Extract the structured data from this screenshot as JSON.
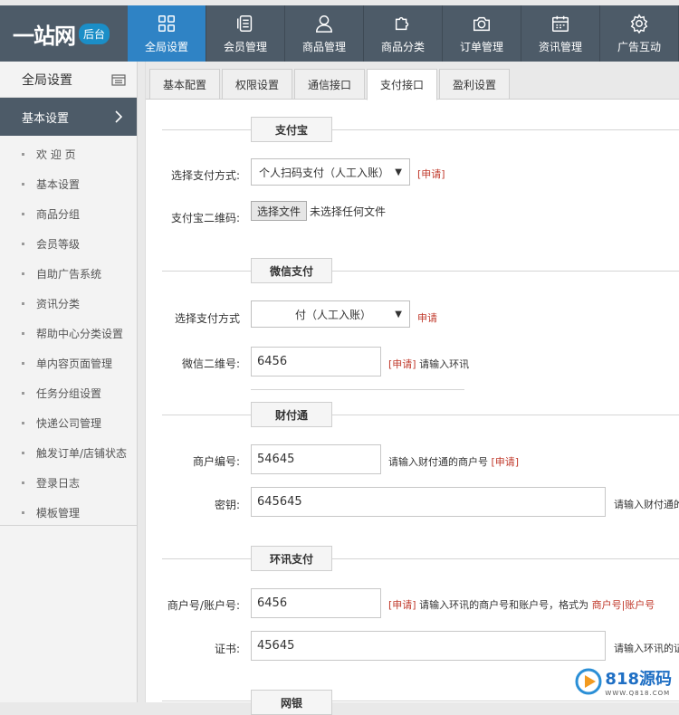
{
  "logo": {
    "text": "一站网",
    "badge": "后台"
  },
  "nav": [
    {
      "label": "全局设置",
      "icon": "grid-icon",
      "active": true
    },
    {
      "label": "会员管理",
      "icon": "id-card-icon"
    },
    {
      "label": "商品管理",
      "icon": "user-icon"
    },
    {
      "label": "商品分类",
      "icon": "puzzle-icon"
    },
    {
      "label": "订单管理",
      "icon": "camera-icon"
    },
    {
      "label": "资讯管理",
      "icon": "calendar-icon"
    },
    {
      "label": "广告互动",
      "icon": "gear-icon"
    }
  ],
  "sidebar": {
    "title": "全局设置",
    "active": "基本设置",
    "items": [
      "欢 迎 页",
      "基本设置",
      "商品分组",
      "会员等级",
      "自助广告系统",
      "资讯分类",
      "帮助中心分类设置",
      "单内容页面管理",
      "任务分组设置",
      "快递公司管理",
      "触发订单/店铺状态",
      "登录日志",
      "模板管理"
    ]
  },
  "tabs": [
    "基本配置",
    "权限设置",
    "通信接口",
    "支付接口",
    "盈利设置"
  ],
  "alipay": {
    "title": "支付宝",
    "method_label": "选择支付方式:",
    "method_value": "个人扫码支付（人工入账）",
    "apply": "[申请]",
    "qr_label": "支付宝二维码:",
    "file_button": "选择文件",
    "file_status": "未选择任何文件"
  },
  "wechat": {
    "title": "微信支付",
    "method_label": "选择支付方式",
    "method_value": "付（人工入账）",
    "apply": "申请",
    "qr_label": "微信二维",
    "qr_label_suffix": "号:",
    "qr_value": "6456",
    "qr_apply": "[申请]",
    "qr_hint": "请输入环讯"
  },
  "tenpay": {
    "title": "财付通",
    "merchant_label": "商户编号:",
    "merchant_value": "54645",
    "merchant_hint": "请输入财付通的商户号",
    "merchant_apply": "[申请]",
    "key_label": "密钥:",
    "key_value": "645645",
    "key_hint": "请输入财付通的"
  },
  "ips": {
    "title": "环讯支付",
    "merchant_label": "商户号/账户号:",
    "merchant_value": "6456",
    "apply": "[申请]",
    "hint_prefix": "请输入环讯的商户号和账户号，格式为",
    "hint_format": "商户号|账户号",
    "cert_label": "证书:",
    "cert_value": "45645",
    "cert_hint": "请输入环讯的证"
  },
  "next_section": {
    "title": "网银"
  },
  "watermark": {
    "brand": "818源码",
    "url": "WWW.Q818.COM"
  },
  "colors": {
    "topbar": "#4d5b68",
    "nav_active": "#2f83c5",
    "apply": "#c0392b"
  }
}
